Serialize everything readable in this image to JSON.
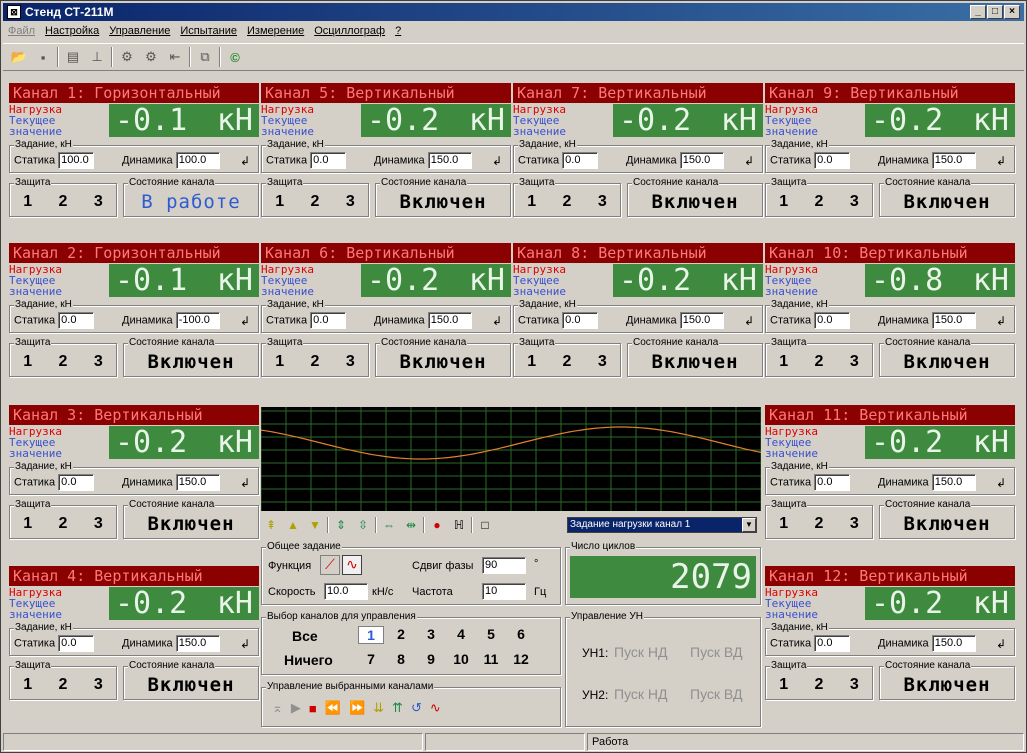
{
  "window": {
    "title": "Стенд СТ-211М"
  },
  "menu": [
    "Файл",
    "Настройка",
    "Управление",
    "Испытание",
    "Измерение",
    "Осциллограф",
    "?"
  ],
  "labels": {
    "load": "Нагрузка",
    "current": "Текущее",
    "value": "значение",
    "assign": "Задание, кН",
    "static": "Статика",
    "dynamic": "Динамика",
    "protect": "Защита",
    "state": "Состояние канала",
    "unit": "кН",
    "enter": "↲"
  },
  "channels": [
    {
      "head": "Канал 1: Горизонтальный",
      "value": "-0.1",
      "static": "100.0",
      "dynamic": "100.0",
      "state": "В работе",
      "p": [
        "1",
        "2",
        "3"
      ]
    },
    {
      "head": "Канал 5: Вертикальный",
      "value": "-0.2",
      "static": "0.0",
      "dynamic": "150.0",
      "state": "Включен",
      "p": [
        "1",
        "2",
        "3"
      ]
    },
    {
      "head": "Канал 7: Вертикальный",
      "value": "-0.2",
      "static": "0.0",
      "dynamic": "150.0",
      "state": "Включен",
      "p": [
        "1",
        "2",
        "3"
      ]
    },
    {
      "head": "Канал 9: Вертикальный",
      "value": "-0.2",
      "static": "0.0",
      "dynamic": "150.0",
      "state": "Включен",
      "p": [
        "1",
        "2",
        "3"
      ]
    },
    {
      "head": "Канал 2: Горизонтальный",
      "value": "-0.1",
      "static": "0.0",
      "dynamic": "-100.0",
      "state": "Включен",
      "p": [
        "1",
        "2",
        "3"
      ]
    },
    {
      "head": "Канал 6: Вертикальный",
      "value": "-0.2",
      "static": "0.0",
      "dynamic": "150.0",
      "state": "Включен",
      "p": [
        "1",
        "2",
        "3"
      ]
    },
    {
      "head": "Канал 8: Вертикальный",
      "value": "-0.2",
      "static": "0.0",
      "dynamic": "150.0",
      "state": "Включен",
      "p": [
        "1",
        "2",
        "3"
      ]
    },
    {
      "head": "Канал 10: Вертикальный",
      "value": "-0.8",
      "static": "0.0",
      "dynamic": "150.0",
      "state": "Включен",
      "p": [
        "1",
        "2",
        "3"
      ]
    },
    {
      "head": "Канал 3: Вертикальный",
      "value": "-0.2",
      "static": "0.0",
      "dynamic": "150.0",
      "state": "Включен",
      "p": [
        "1",
        "2",
        "3"
      ]
    },
    {
      "head": "Канал 11: Вертикальный",
      "value": "-0.2",
      "static": "0.0",
      "dynamic": "150.0",
      "state": "Включен",
      "p": [
        "1",
        "2",
        "3"
      ]
    },
    {
      "head": "Канал 4: Вертикальный",
      "value": "-0.2",
      "static": "0.0",
      "dynamic": "150.0",
      "state": "Включен",
      "p": [
        "1",
        "2",
        "3"
      ]
    },
    {
      "head": "Канал 12: Вертикальный",
      "value": "-0.2",
      "static": "0.0",
      "dynamic": "150.0",
      "state": "Включен",
      "p": [
        "1",
        "2",
        "3"
      ]
    }
  ],
  "scope": {
    "select": "Задание нагрузки канал 1"
  },
  "general": {
    "title": "Общее задание",
    "func": "Функция",
    "phase": "Сдвиг фазы",
    "phase_val": "90",
    "phase_unit": "°",
    "speed": "Скорость",
    "speed_val": "10.0",
    "speed_unit": "кН/с",
    "freq": "Частота",
    "freq_val": "10",
    "freq_unit": "Гц"
  },
  "cycles": {
    "title": "Число циклов",
    "value": "2079"
  },
  "select": {
    "title": "Выбор каналов для управления",
    "all": "Все",
    "none": "Ничего",
    "row1": [
      "1",
      "2",
      "3",
      "4",
      "5",
      "6"
    ],
    "row2": [
      "7",
      "8",
      "9",
      "10",
      "11",
      "12"
    ]
  },
  "un": {
    "title": "Управление УН",
    "un1": "УН1:",
    "un2": "УН2:",
    "nd": "Пуск НД",
    "vd": "Пуск ВД"
  },
  "ctrl": {
    "title": "Управление выбранными каналами"
  },
  "status": {
    "text": "Работа"
  }
}
